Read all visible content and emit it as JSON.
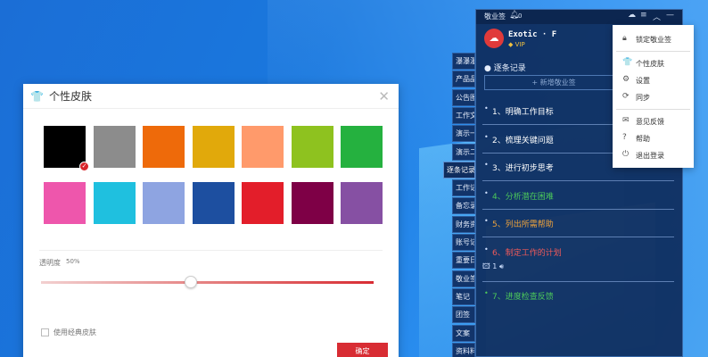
{
  "skin_dialog": {
    "title": "个性皮肤",
    "opacity_label": "透明度",
    "opacity_value": "50%",
    "opacity_level": 0.45,
    "classic_skin_label": "使用经典皮肤",
    "confirm_label": "确定",
    "selected_index": 0,
    "swatches": [
      "#000000",
      "#8c8c8c",
      "#ee6a0a",
      "#e1a90b",
      "#ff9a6b",
      "#8ec21f",
      "#25b13f",
      "#ee56ac",
      "#1fc0df",
      "#8ea4e1",
      "#1d4fa0",
      "#e31e2a",
      "#7e0046",
      "#8650a3"
    ]
  },
  "side_tabs": [
    "瀑瀑瀑",
    "产品品",
    "公告图",
    "工作文",
    "演示一",
    "演示二",
    "逐条记录",
    "工作记",
    "备忘录",
    "财务资",
    "账号记",
    "重要日",
    "敬业签",
    "笔记",
    "团签",
    "文案",
    "资料料"
  ],
  "app": {
    "name": "敬业签",
    "notification_count": "0",
    "user_name": "Exotic · F",
    "vip_label": "VIP",
    "section_title": "逐条记录",
    "new_button": "+ 新增敬业签",
    "tasks": [
      {
        "text": "1、明确工作目标",
        "color": "#ffffff"
      },
      {
        "text": "2、梳理关键问题",
        "color": "#ffffff"
      },
      {
        "text": "3、进行初步思考",
        "color": "#ffffff"
      },
      {
        "text": "4、分析潜在困难",
        "color": "#4cc95a"
      },
      {
        "text": "5、列出所需帮助",
        "color": "#f0a43c"
      },
      {
        "text": "6、制定工作的计划",
        "color": "#f05a5a"
      },
      {
        "text": "7、进度检查反馈",
        "color": "#4cc95a"
      }
    ],
    "attachment_count": "1"
  },
  "menu": {
    "items": [
      "锁定敬业签",
      "个性皮肤",
      "设置",
      "同步",
      "意见反馈",
      "帮助",
      "退出登录"
    ]
  }
}
